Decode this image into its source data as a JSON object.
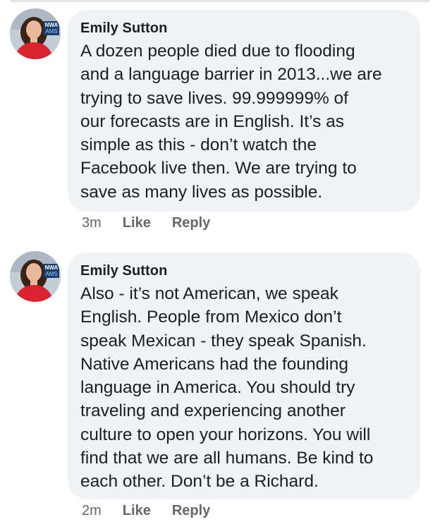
{
  "comments": [
    {
      "author": "Emily Sutton",
      "avatar_badge_top": "NWA",
      "avatar_badge_bottom": "AMS",
      "text": "A dozen people died due to flooding\nand a language barrier in 2013...we are\ntrying to save lives. 99.999999% of\nour forecasts are in English. It’s as\nsimple as this - don’t watch the\nFacebook live then. We are trying to\nsave as many lives as possible.",
      "time": "3m",
      "like_label": "Like",
      "reply_label": "Reply"
    },
    {
      "author": "Emily Sutton",
      "avatar_badge_top": "NWA",
      "avatar_badge_bottom": "AMS",
      "text": "Also - it’s not American, we speak\nEnglish. People from Mexico don’t\nspeak Mexican - they speak Spanish.\nNative Americans had the founding\nlanguage in America. You should try\ntraveling and experiencing another\nculture to open your horizons. You will\nfind that we are all humans. Be kind to\neach other. Don’t be a Richard.",
      "time": "2m",
      "like_label": "Like",
      "reply_label": "Reply"
    }
  ],
  "colors": {
    "bubble_bg": "#f0f2f5",
    "text": "#1c1e21",
    "meta": "#65676b",
    "avatar_shirt": "#d9232e"
  }
}
